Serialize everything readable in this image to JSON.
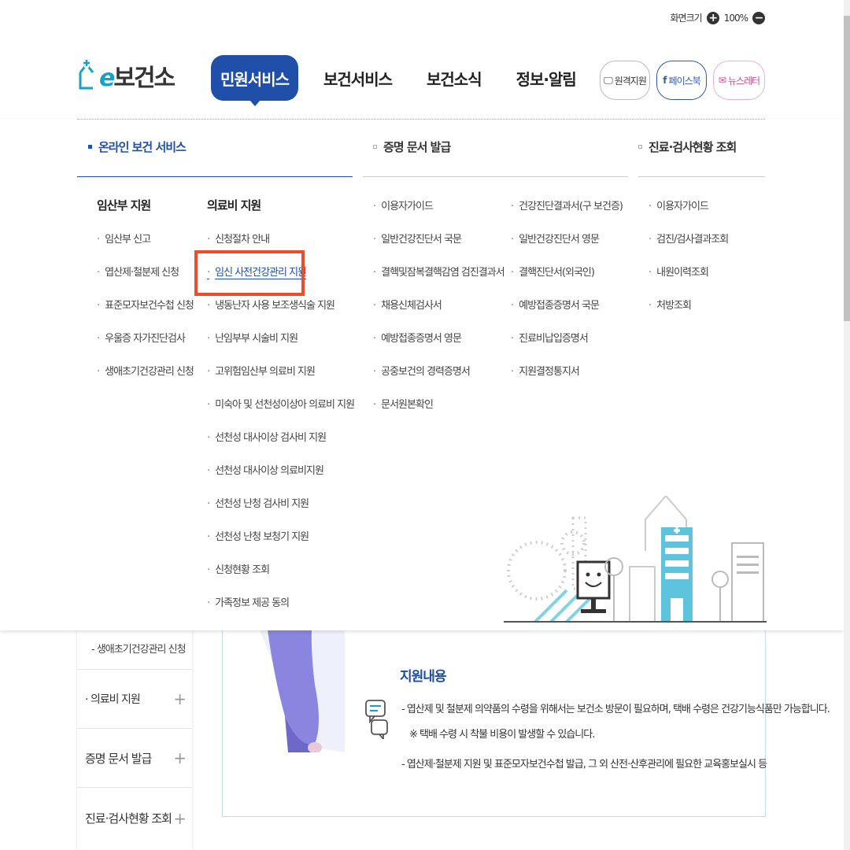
{
  "topbar": {
    "zoom_label": "화면크기",
    "zoom_value": "100%",
    "zoom_in": "+",
    "zoom_out": "−"
  },
  "logo": {
    "prefix": "e",
    "text": "보건소"
  },
  "gnb": {
    "items": [
      "민원서비스",
      "보건서비스",
      "보건소식",
      "정보·알림"
    ],
    "active_index": 0
  },
  "header_buttons": {
    "remote": "원격지원",
    "facebook": "페이스북",
    "newsletter": "뉴스레터"
  },
  "mega_menu": {
    "col1": {
      "title": "온라인 보건 서비스",
      "group1": {
        "heading": "임산부 지원",
        "items": [
          "임산부 신고",
          "엽산제·철분제 신청",
          "표준모자보건수첩 신청",
          "우울증 자가진단검사",
          "생애초기건강관리 신청"
        ]
      },
      "group2": {
        "heading": "의료비 지원",
        "items": [
          "신청절차 안내",
          "임신 사전건강관리 지원",
          "냉동난자 사용 보조생식술 지원",
          "난임부부 시술비 지원",
          "고위험임산부 의료비 지원",
          "미숙아 및 선천성이상아 의료비 지원",
          "선천성 대사이상 검사비 지원",
          "선천성 대사이상 의료비지원",
          "선천성 난청 검사비 지원",
          "선천성 난청 보청기 지원",
          "신청현황 조회",
          "가족정보 제공 동의"
        ],
        "highlighted_index": 1
      }
    },
    "col2": {
      "title": "증명 문서 발급",
      "left_items": [
        "이용자가이드",
        "일반건강진단서 국문",
        "결핵및잠복결핵감염 검진결과서",
        "채용신체검사서",
        "예방접종증명서 영문",
        "공중보건의 경력증명서",
        "문서원본확인"
      ],
      "right_items": [
        "건강진단결과서(구 보건증)",
        "일반건강진단서 영문",
        "결핵진단서(외국인)",
        "예방접종증명서 국문",
        "진료비납입증명서",
        "지원결정통지서"
      ]
    },
    "col3": {
      "title": "진료·검사현황 조회",
      "items": [
        "이용자가이드",
        "검진/검사결과조회",
        "내원이력조회",
        "처방조회"
      ]
    }
  },
  "background_page": {
    "sidebar": {
      "sub_item": "생애초기건강관리 신청",
      "items": [
        "의료비 지원",
        "증명 문서 발급",
        "진료·검사현황 조회"
      ]
    },
    "content": {
      "title": "지원내용",
      "line1": "- 엽산제 및 철분제 의약품의 수령을 위해서는 보건소 방문이 필요하며, 택배 수령은 건강기능식품만 가능합니다.",
      "line2": "※ 택배 수령 시 착불 비용이 발생할 수 있습니다.",
      "line3": "- 엽산제·철분제 지원 및 표준모자보건수첩 발급, 그 외 산전·산후관리에 필요한 교육홍보실시 등"
    }
  },
  "colors": {
    "brand_blue": "#1f4fa8",
    "highlight_red": "#ee4b2b",
    "logo_teal": "#16a2c4"
  }
}
